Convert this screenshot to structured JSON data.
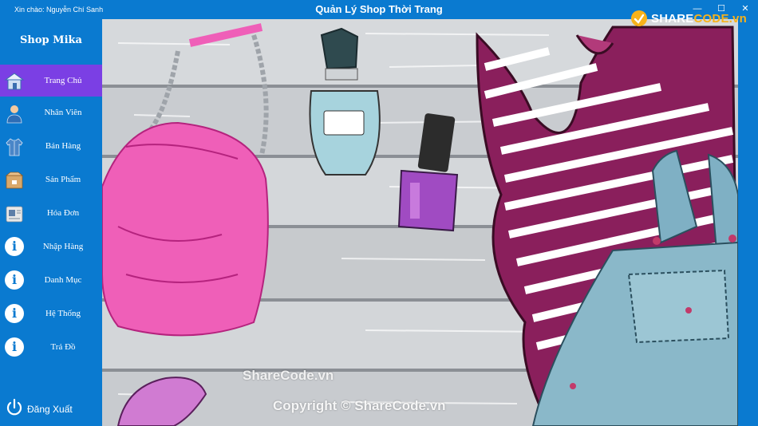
{
  "window": {
    "greeting": "Xin chào: Nguyễn Chí Sanh",
    "title": "Quản Lý Shop Thời Trang",
    "minimize_glyph": "—",
    "maximize_glyph": "☐",
    "close_glyph": "✕"
  },
  "sidebar": {
    "brand": "Shop Mika",
    "items": [
      {
        "label": "Trang Chủ",
        "icon": "home-icon",
        "active": true
      },
      {
        "label": "Nhân Viên",
        "icon": "employee-icon"
      },
      {
        "label": "Bán Hàng",
        "icon": "shirt-icon"
      },
      {
        "label": "Sản Phẩm",
        "icon": "box-icon"
      },
      {
        "label": "Hóa Đơn",
        "icon": "invoice-icon"
      },
      {
        "label": "Nhập Hàng",
        "icon": "info-icon"
      },
      {
        "label": "Danh Mục",
        "icon": "info-icon"
      },
      {
        "label": "Hệ Thống",
        "icon": "info-icon"
      },
      {
        "label": "Trả Đồ",
        "icon": "info-icon"
      }
    ],
    "info_glyph": "i",
    "logout": {
      "label": "Đăng Xuất",
      "icon": "power-icon"
    }
  },
  "watermark": {
    "line1": "ShareCode.vn",
    "line2": "Copyright © ShareCode.vn"
  },
  "logo": {
    "part1": "SHARE",
    "part2": "CODE.vn"
  },
  "colors": {
    "primary": "#0a7ad0",
    "active": "#7b3fe4",
    "accent": "#f7b21a"
  }
}
